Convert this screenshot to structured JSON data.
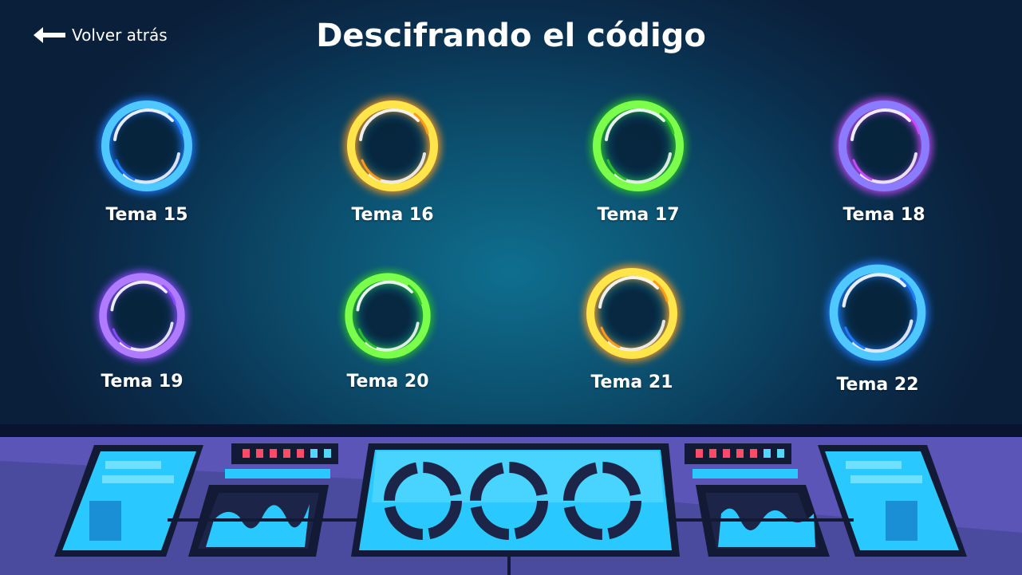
{
  "header": {
    "back_label": "Volver atrás",
    "title": "Descifrando el código"
  },
  "topics": [
    {
      "label": "Tema 15",
      "color": "#4fc8ff",
      "glow": "#1e7bff"
    },
    {
      "label": "Tema 16",
      "color": "#ffe44a",
      "glow": "#ff9a1a"
    },
    {
      "label": "Tema 17",
      "color": "#7cff4a",
      "glow": "#2bbf2b"
    },
    {
      "label": "Tema 18",
      "color": "#8a7bff",
      "glow": "#c84aff"
    },
    {
      "label": "Tema 19",
      "color": "#b07bff",
      "glow": "#8a4aff"
    },
    {
      "label": "Tema 20",
      "color": "#7cff4a",
      "glow": "#2bbf2b"
    },
    {
      "label": "Tema 21",
      "color": "#ffe44a",
      "glow": "#ff9a1a"
    },
    {
      "label": "Tema 22",
      "color": "#4fc8ff",
      "glow": "#1e7bff"
    }
  ],
  "console": {
    "screen_color": "#29c8ff",
    "panel_color": "#5b55b8",
    "frame_color": "#121a36",
    "indicator_colors": [
      "#ff4a6a",
      "#4fd8ff"
    ]
  }
}
